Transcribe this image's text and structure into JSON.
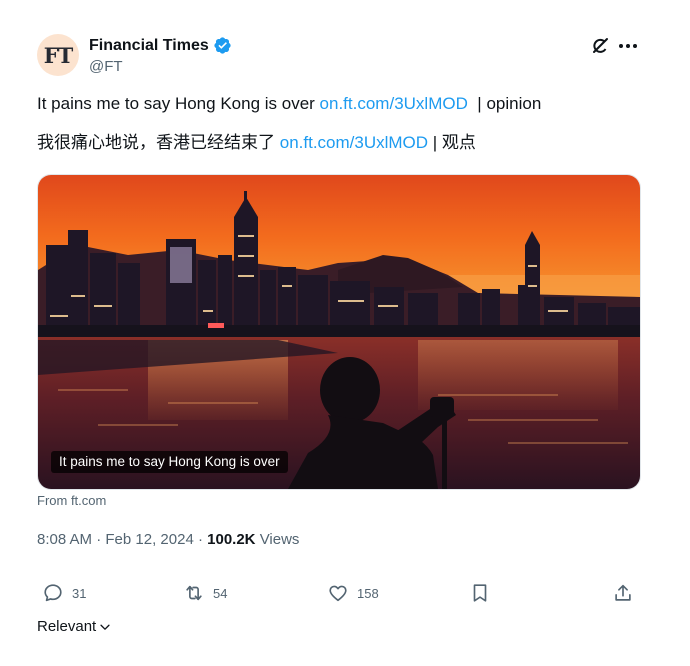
{
  "author": {
    "avatar_text": "FT",
    "name": "Financial Times",
    "handle": "@FT",
    "verified_color": "#1d9bf0"
  },
  "tweet": {
    "line1_text": "It pains me to say Hong Kong is over ",
    "line1_link": "on.ft.com/3UxlMOD",
    "line1_suffix": "  | opinion",
    "line2_text": "我很痛心地说，香港已经结束了 ",
    "line2_link": "on.ft.com/3UxlMOD",
    "line2_suffix": " | 观点"
  },
  "media": {
    "caption": "It pains me to say Hong Kong is over",
    "source": "From ft.com"
  },
  "meta": {
    "time": "8:08 AM",
    "separator": " · ",
    "date": "Feb 12, 2024",
    "views_count": "100.2K",
    "views_label": "Views"
  },
  "actions": {
    "replies": "31",
    "reposts": "54",
    "likes": "158"
  },
  "sort": {
    "label": "Relevant"
  },
  "icons": [
    "verified-icon",
    "grok-icon",
    "more-icon",
    "reply-icon",
    "repost-icon",
    "like-icon",
    "bookmark-icon",
    "share-icon",
    "chevron-down-icon"
  ]
}
